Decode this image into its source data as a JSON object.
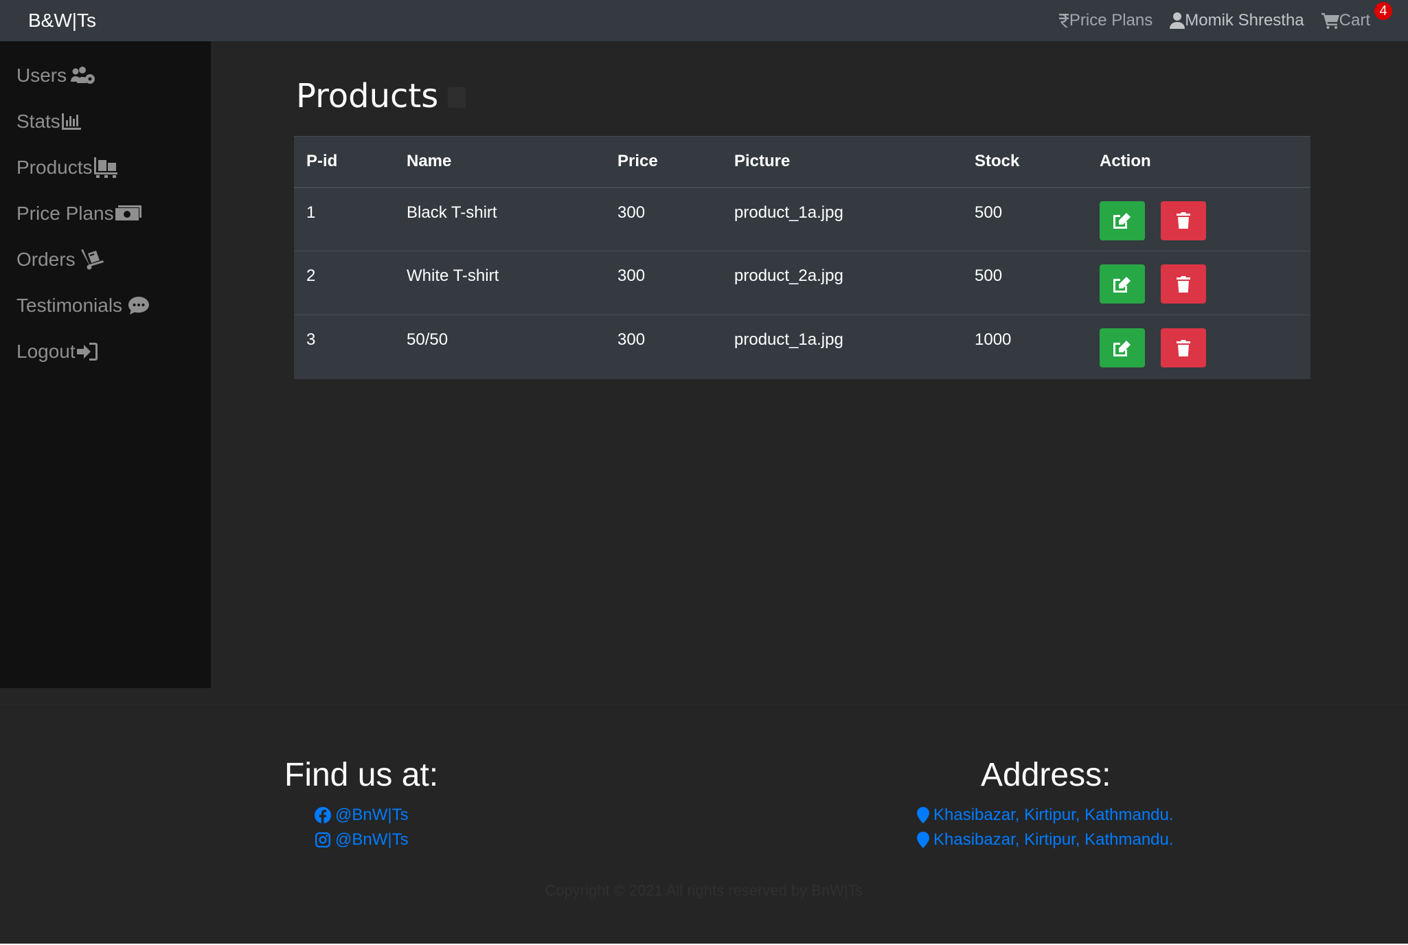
{
  "navbar": {
    "brand": "B&W|Ts",
    "price_plans": "Price Plans",
    "user_name": "Momik Shrestha",
    "cart_label": "Cart",
    "cart_count": "4"
  },
  "sidebar": {
    "items": [
      {
        "label": "Users",
        "icon": "users-cog-icon"
      },
      {
        "label": "Stats",
        "icon": "chart-bar-icon"
      },
      {
        "label": "Products",
        "icon": "pallet-icon"
      },
      {
        "label": "Price Plans",
        "icon": "money-bill-icon"
      },
      {
        "label": "Orders",
        "icon": "dolly-icon"
      },
      {
        "label": "Testimonials",
        "icon": "comment-icon"
      },
      {
        "label": "Logout",
        "icon": "sign-out-icon"
      }
    ]
  },
  "main": {
    "title": "Products",
    "table": {
      "headers": [
        "P-id",
        "Name",
        "Price",
        "Picture",
        "Stock",
        "Action"
      ],
      "rows": [
        {
          "pid": "1",
          "name": "Black T-shirt",
          "price": "300",
          "picture": "product_1a.jpg",
          "stock": "500"
        },
        {
          "pid": "2",
          "name": "White T-shirt",
          "price": "300",
          "picture": "product_2a.jpg",
          "stock": "500"
        },
        {
          "pid": "3",
          "name": "50/50",
          "price": "300",
          "picture": "product_1a.jpg",
          "stock": "1000"
        }
      ]
    }
  },
  "footer": {
    "find_us_heading": "Find us at:",
    "facebook": "@BnW|Ts",
    "instagram": "@BnW|Ts",
    "address_heading": "Address:",
    "address_1": "Khasibazar, Kirtipur, Kathmandu.",
    "address_2": "Khasibazar, Kirtipur, Kathmandu.",
    "copyright": "Copyright © 2021 All rights reserved by BnW|Ts"
  },
  "colors": {
    "navbar": "#343a40",
    "sidebar": "#111111",
    "background": "#252525",
    "edit_button": "#28a745",
    "delete_button": "#dc3545",
    "link": "#007bff",
    "badge": "#dc0000"
  }
}
